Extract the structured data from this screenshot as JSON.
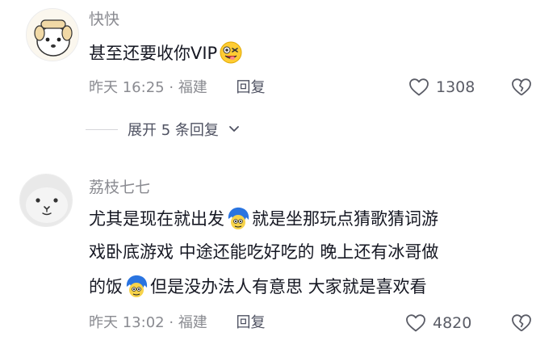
{
  "comments": [
    {
      "username": "快快",
      "text": "甚至还要收你VIP",
      "emoji": "grinning-face-emoji",
      "time": "昨天 16:25",
      "location": "福建",
      "reply_label": "回复",
      "likes": "1308"
    },
    {
      "username": "荔枝七七",
      "line1_a": "尤其是现在就出发",
      "line1_b": "就是坐那玩点猜歌猜词游",
      "line2": "戏卧底游戏 中途还能吃好吃的 晚上还有冰哥做",
      "line3_a": "的饭",
      "line3_b": "但是没办法人有意思 大家就是喜欢看",
      "emoji": "blue-hair-sticker-emoji",
      "time": "昨天 13:02",
      "location": "福建",
      "reply_label": "回复",
      "likes": "4820"
    }
  ],
  "expand_replies": "展开 5 条回复",
  "separator": "·",
  "colors": {
    "text": "#161823",
    "meta": "#8a8b91",
    "reply": "#4e5161"
  }
}
